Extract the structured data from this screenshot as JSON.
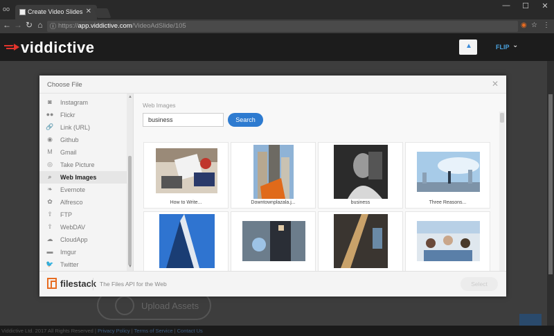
{
  "browser": {
    "tab_title": "Create Video Slides",
    "url_scheme": "https://",
    "url_host": "app.viddictive.com",
    "url_path": "/VideoAdSlide/105"
  },
  "app": {
    "logo_text": "viddictive",
    "user_label": "FLIP",
    "brand_accent": "#e2342c"
  },
  "modal": {
    "title": "Choose File",
    "sidebar": [
      {
        "label": "Instagram",
        "icon": "instagram-icon",
        "glyph": "◙"
      },
      {
        "label": "Flickr",
        "icon": "flickr-icon",
        "glyph": "●●"
      },
      {
        "label": "Link (URL)",
        "icon": "link-icon",
        "glyph": "🔗"
      },
      {
        "label": "Github",
        "icon": "github-icon",
        "glyph": "◉"
      },
      {
        "label": "Gmail",
        "icon": "gmail-icon",
        "glyph": "M"
      },
      {
        "label": "Take Picture",
        "icon": "camera-icon",
        "glyph": "◎"
      },
      {
        "label": "Web Images",
        "icon": "search-icon",
        "glyph": "⌕",
        "active": true
      },
      {
        "label": "Evernote",
        "icon": "evernote-icon",
        "glyph": "❧"
      },
      {
        "label": "Alfresco",
        "icon": "alfresco-icon",
        "glyph": "✿"
      },
      {
        "label": "FTP",
        "icon": "ftp-icon",
        "glyph": "⇧"
      },
      {
        "label": "WebDAV",
        "icon": "webdav-icon",
        "glyph": "⇧"
      },
      {
        "label": "CloudApp",
        "icon": "cloud-icon",
        "glyph": "☁"
      },
      {
        "label": "Imgur",
        "icon": "imgur-icon",
        "glyph": "▬"
      },
      {
        "label": "Twitter",
        "icon": "twitter-icon",
        "glyph": "🐦"
      }
    ],
    "content": {
      "section_label": "Web Images",
      "search_value": "business",
      "search_button": "Search",
      "results": [
        {
          "caption": "How to Write..."
        },
        {
          "caption": "Downtownplazala.j..."
        },
        {
          "caption": "business"
        },
        {
          "caption": "Three Reasons..."
        },
        {
          "caption": ""
        },
        {
          "caption": ""
        },
        {
          "caption": ""
        },
        {
          "caption": ""
        }
      ]
    },
    "footer": {
      "brand": "filestack",
      "tagline": "The Files API for the Web",
      "select_button": "Select"
    }
  },
  "page": {
    "ghost_button": "Upload Assets",
    "footer_text": "Viddictive Ltd. 2017 All Rights Reserved",
    "footer_links": [
      "Privacy Policy",
      "Terms of Service",
      "Contact Us"
    ]
  }
}
